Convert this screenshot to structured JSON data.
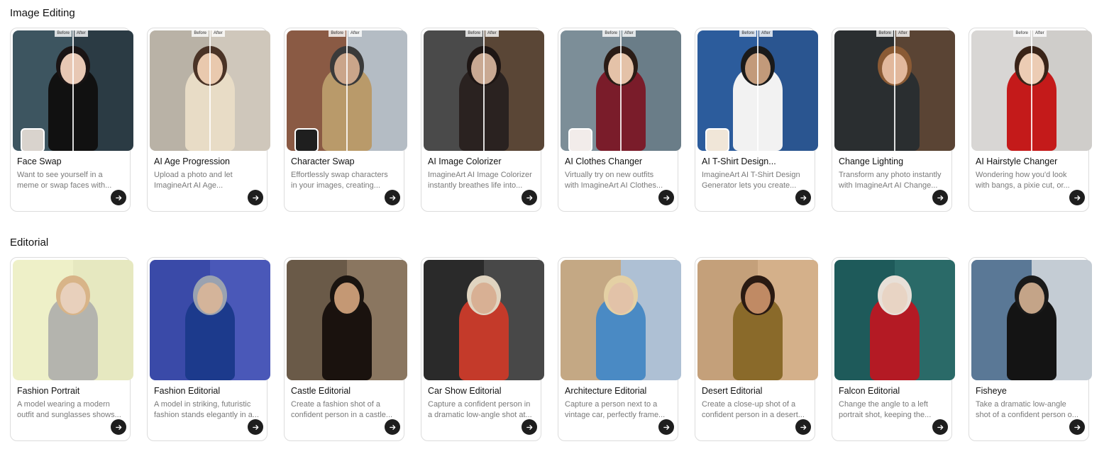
{
  "sections": [
    {
      "title": "Image Editing",
      "cards": [
        {
          "title": "Face Swap",
          "desc": [
            "Want to see yourself in a",
            "meme or swap faces with..."
          ],
          "before": "Before",
          "after": "After",
          "colors": [
            "#3d5560",
            "#2b3b44"
          ],
          "skin": "#e8c8b4",
          "hair": "#1a1414",
          "cloth": "#111111",
          "source": true,
          "source_color": "#d9d3cd"
        },
        {
          "title": "AI Age Progression",
          "desc": [
            "Upload a photo and let",
            "ImagineArt AI Age..."
          ],
          "before": "Before",
          "after": "After",
          "colors": [
            "#b9b2a6",
            "#cfc7bb"
          ],
          "skin": "#e9c9ae",
          "hair": "#4a3326",
          "cloth": "#e8dcc6",
          "source": false
        },
        {
          "title": "Character Swap",
          "desc": [
            "Effortlessly swap characters",
            "in your images, creating..."
          ],
          "before": "Before",
          "after": "After",
          "colors": [
            "#8a5a44",
            "#b4bcc4"
          ],
          "skin": "#caa58a",
          "hair": "#3a3a3a",
          "cloth": "#b99a6a",
          "source": true,
          "source_color": "#1f1f1f"
        },
        {
          "title": "AI Image Colorizer",
          "desc": [
            "ImagineArt AI Image Colorizer",
            "instantly breathes life into..."
          ],
          "before": "Before",
          "after": "After",
          "colors": [
            "#4a4a4a",
            "#5a4636"
          ],
          "skin": "#c9a993",
          "hair": "#1e1614",
          "cloth": "#2a2220",
          "source": false
        },
        {
          "title": "AI Clothes Changer",
          "desc": [
            "Virtually try on new outfits",
            "with ImagineArt AI Clothes..."
          ],
          "before": "Before",
          "after": "After",
          "colors": [
            "#7c8e98",
            "#6a7d88"
          ],
          "skin": "#e4c2a8",
          "hair": "#2a1c16",
          "cloth": "#7a1c2a",
          "source": true,
          "source_color": "#f2ecea"
        },
        {
          "title": "AI T-Shirt Design...",
          "desc": [
            "ImagineArt AI T-Shirt Design",
            "Generator lets you create..."
          ],
          "before": "Before",
          "after": "After",
          "colors": [
            "#2c5c9c",
            "#2a5590"
          ],
          "skin": "#c29a7a",
          "hair": "#1a1a1a",
          "cloth": "#f2f2f2",
          "source": true,
          "source_color": "#f0e6d8"
        },
        {
          "title": "Change Lighting",
          "desc": [
            "Transform any photo instantly",
            "with ImagineArt AI Change..."
          ],
          "before": "Before",
          "after": "After",
          "colors": [
            "#2a2e30",
            "#5a4434"
          ],
          "skin": "#e2b89c",
          "hair": "#8a5a34",
          "cloth": "#2a2e30",
          "source": false
        },
        {
          "title": "AI Hairstyle Changer",
          "desc": [
            "Wondering how you'd look",
            "with bangs, a pixie cut, or..."
          ],
          "before": "Before",
          "after": "After",
          "colors": [
            "#d8d6d4",
            "#cfcdca"
          ],
          "skin": "#ecccb4",
          "hair": "#3a2418",
          "cloth": "#c41a1a",
          "source": false
        }
      ]
    },
    {
      "title": "Editorial",
      "cards": [
        {
          "title": "Fashion Portrait",
          "desc": [
            "A model wearing a modern",
            "outfit and sunglasses shows..."
          ],
          "colors": [
            "#eef0c8",
            "#e6e8c0"
          ],
          "skin": "#e8d0bc",
          "hair": "#d8b488",
          "cloth": "#b4b4ae"
        },
        {
          "title": "Fashion Editorial",
          "desc": [
            "A model in striking, futuristic",
            "fashion stands elegantly in a..."
          ],
          "colors": [
            "#3a4aa8",
            "#4a58b8"
          ],
          "skin": "#d4b49a",
          "hair": "#9aa2b0",
          "cloth": "#1c3a8c"
        },
        {
          "title": "Castle Editorial",
          "desc": [
            "Create a fashion shot of a",
            "confident person in a castle..."
          ],
          "colors": [
            "#6a5a48",
            "#8a7660"
          ],
          "skin": "#c49874",
          "hair": "#1a1410",
          "cloth": "#1a120e"
        },
        {
          "title": "Car Show Editorial",
          "desc": [
            "Capture a confident person in",
            "a dramatic low-angle shot at..."
          ],
          "colors": [
            "#2a2a2a",
            "#484848"
          ],
          "skin": "#d8b094",
          "hair": "#e0d4c0",
          "cloth": "#c43a2a"
        },
        {
          "title": "Architecture Editorial",
          "desc": [
            "Capture a person next to a",
            "vintage car, perfectly frame..."
          ],
          "colors": [
            "#c4a884",
            "#aec0d4"
          ],
          "skin": "#e2c2a8",
          "hair": "#e4d0a4",
          "cloth": "#4a8ac4"
        },
        {
          "title": "Desert Editorial",
          "desc": [
            "Create a close-up shot of a",
            "confident person in a desert..."
          ],
          "colors": [
            "#c4a07a",
            "#d4b08a"
          ],
          "skin": "#c08a64",
          "hair": "#2a1a12",
          "cloth": "#8a6a2a"
        },
        {
          "title": "Falcon Editorial",
          "desc": [
            "Change the angle to a left",
            "portrait shot, keeping the..."
          ],
          "colors": [
            "#1e5a5a",
            "#2a6a68"
          ],
          "skin": "#e8d4c4",
          "hair": "#e8e0d8",
          "cloth": "#b41a24"
        },
        {
          "title": "Fisheye",
          "desc": [
            "Take a dramatic low-angle",
            "shot of a confident person o..."
          ],
          "colors": [
            "#5a7896",
            "#c4ccd4"
          ],
          "skin": "#c4a488",
          "hair": "#1a1a1a",
          "cloth": "#141414"
        }
      ]
    }
  ],
  "icons": {
    "go": "arrow-right-icon"
  }
}
